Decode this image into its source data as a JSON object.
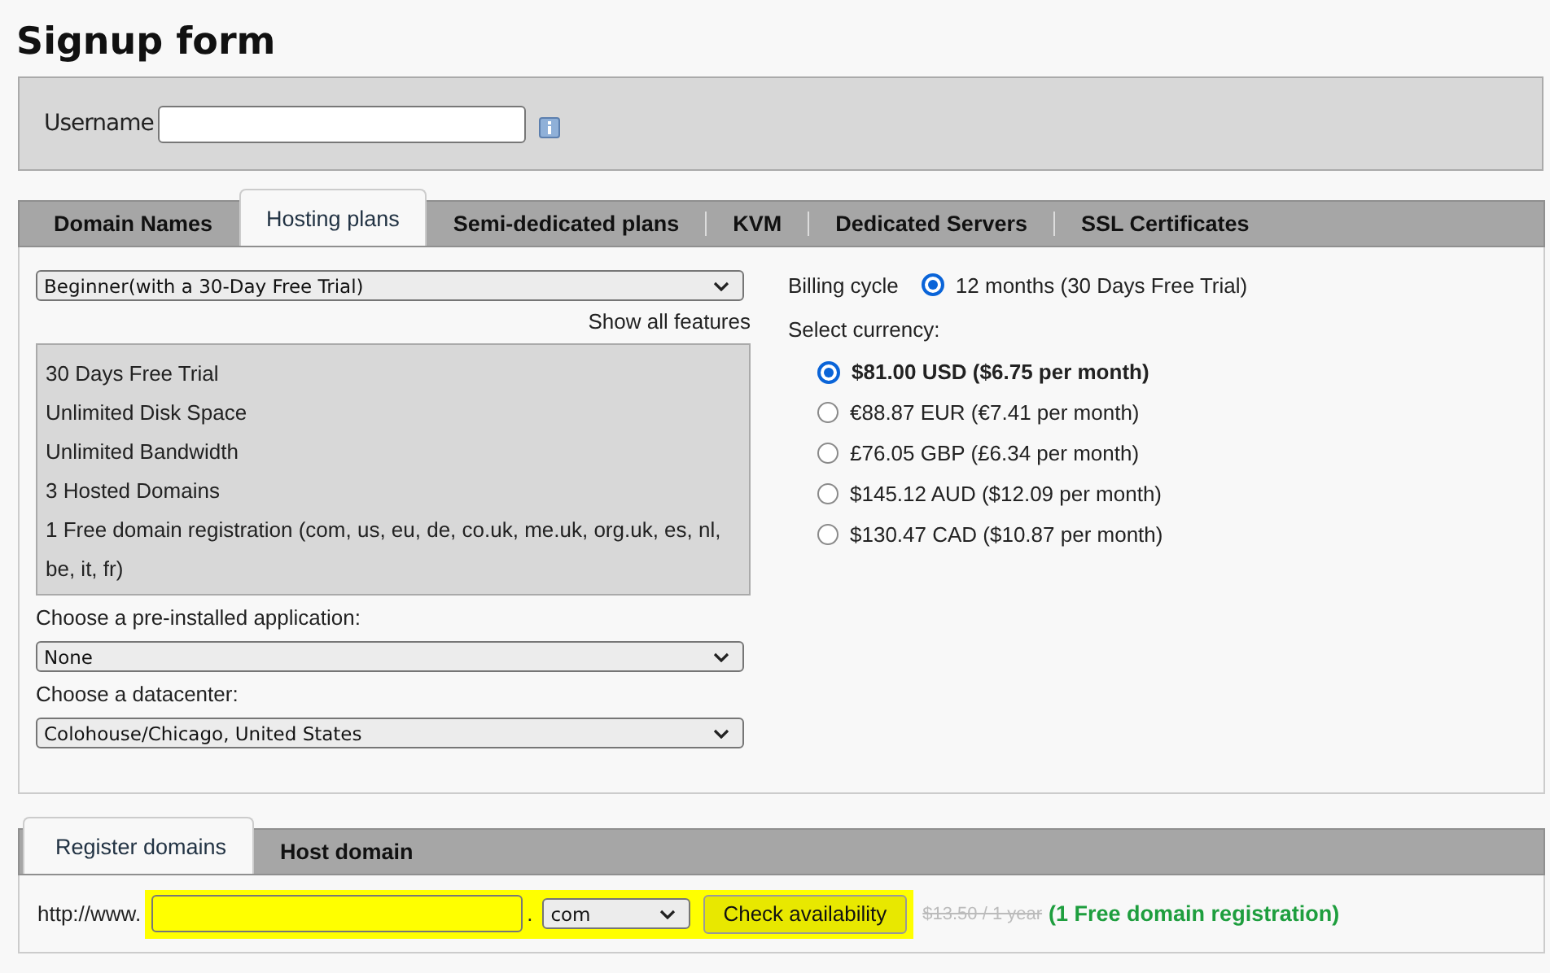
{
  "title": "Signup form",
  "username": {
    "label": "Username"
  },
  "hosting_tabs": [
    {
      "label": "Domain Names",
      "selected": false
    },
    {
      "label": "Hosting plans",
      "selected": true
    },
    {
      "label": "Semi-dedicated plans",
      "selected": false
    },
    {
      "label": "KVM",
      "selected": false
    },
    {
      "label": "Dedicated Servers",
      "selected": false
    },
    {
      "label": "SSL Certificates",
      "selected": false
    }
  ],
  "plan_select": {
    "value": "Beginner(with a 30-Day Free Trial)"
  },
  "show_all_features": "Show all features",
  "features": [
    "30 Days Free Trial",
    "Unlimited Disk Space",
    "Unlimited Bandwidth",
    "3 Hosted Domains",
    "1 Free domain registration (com, us, eu, de, co.uk, me.uk, org.uk, es, nl, be, it, fr)"
  ],
  "application": {
    "label": "Choose a pre-installed application:",
    "value": "None"
  },
  "datacenter": {
    "label": "Choose a datacenter:",
    "value": "Colohouse/Chicago, United States"
  },
  "billing_cycle": {
    "label": "Billing cycle",
    "options": [
      {
        "label": "12 months (30 Days Free Trial)",
        "selected": true
      }
    ]
  },
  "currency": {
    "label": "Select currency:",
    "options": [
      {
        "label": "$81.00 USD ($6.75 per month)",
        "selected": true
      },
      {
        "label": "€88.87 EUR (€7.41 per month)",
        "selected": false
      },
      {
        "label": "£76.05 GBP (£6.34 per month)",
        "selected": false
      },
      {
        "label": "$145.12 AUD ($12.09 per month)",
        "selected": false
      },
      {
        "label": "$130.47 CAD ($10.87 per month)",
        "selected": false
      }
    ]
  },
  "domain_tabs": [
    {
      "label": "Register domains",
      "selected": true
    },
    {
      "label": "Host domain",
      "selected": false
    }
  ],
  "domain": {
    "prefix": "http://www.",
    "separator": ".",
    "tld": "com",
    "button": "Check availability",
    "old_price": "$13.50 / 1 year",
    "note": "(1 Free domain registration)",
    "highlighted": true
  }
}
